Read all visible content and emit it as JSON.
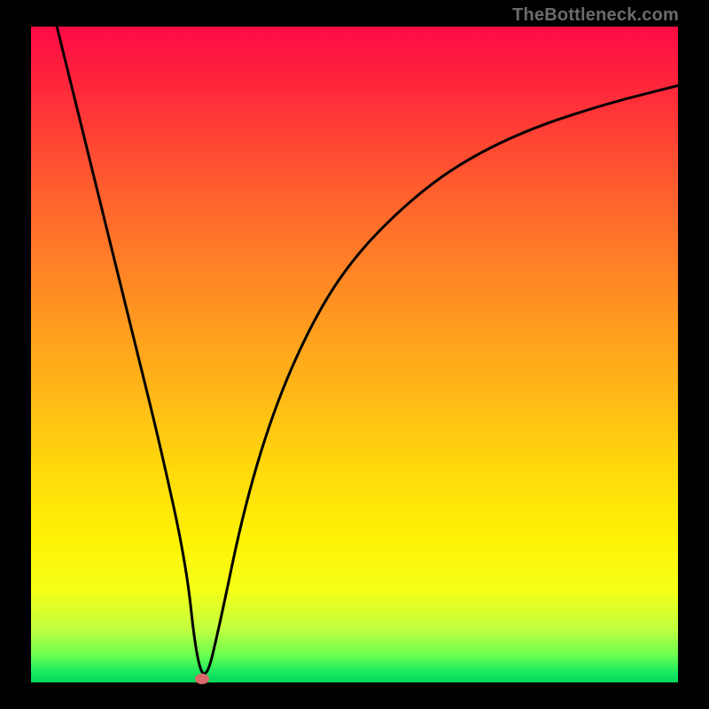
{
  "watermark": "TheBottleneck.com",
  "chart_data": {
    "type": "line",
    "title": "",
    "xlabel": "",
    "ylabel": "",
    "xlim": [
      0,
      100
    ],
    "ylim": [
      0,
      100
    ],
    "x": [
      4,
      8,
      12,
      16,
      20,
      24,
      25.5,
      27,
      29,
      33,
      38,
      44,
      50,
      58,
      66,
      76,
      88,
      100
    ],
    "values": [
      100,
      84,
      68,
      52,
      36,
      18,
      4,
      0,
      8,
      27,
      43,
      56,
      65,
      73,
      79,
      84,
      88,
      91
    ],
    "marker": {
      "x": 26.5,
      "y": 0.5
    },
    "note": "Axes are unlabeled in the image; x/y normalized to 0-100 of plot area. Curve is a V-shape dipping to zero near x≈27 then rising asymptotically. Background gradient runs red (top) → green (bottom)."
  },
  "colors": {
    "background": "#000000",
    "curve": "#000000",
    "marker": "#d96a6a",
    "gradient_top": "#ff0b46",
    "gradient_bottom": "#00d75a"
  }
}
